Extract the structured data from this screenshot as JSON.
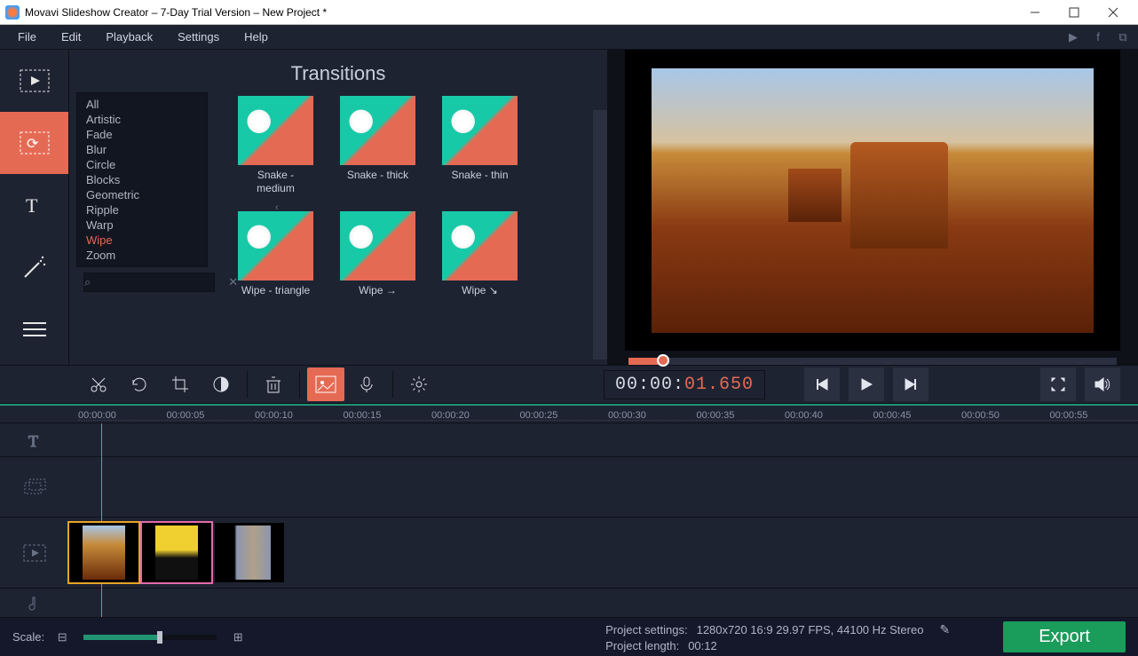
{
  "titlebar": {
    "title": "Movavi Slideshow Creator – 7-Day Trial Version – New Project *"
  },
  "menu": {
    "file": "File",
    "edit": "Edit",
    "playback": "Playback",
    "settings": "Settings",
    "help": "Help"
  },
  "browser": {
    "title": "Transitions",
    "categories": [
      "All",
      "Artistic",
      "Fade",
      "Blur",
      "Circle",
      "Blocks",
      "Geometric",
      "Ripple",
      "Warp",
      "Wipe",
      "Zoom"
    ],
    "selected_category": "Wipe",
    "items": [
      {
        "label": "Snake - medium"
      },
      {
        "label": "Snake - thick"
      },
      {
        "label": "Snake - thin"
      },
      {
        "label": "Wipe - triangle"
      },
      {
        "label": "Wipe →"
      },
      {
        "label": "Wipe ↘"
      }
    ],
    "search_placeholder": "",
    "clear_glyph": "✕"
  },
  "playback": {
    "time_prefix": "00:00:",
    "time_accent": "01.650"
  },
  "ruler": [
    "00:00:00",
    "00:00:05",
    "00:00:10",
    "00:00:15",
    "00:00:20",
    "00:00:25",
    "00:00:30",
    "00:00:35",
    "00:00:40",
    "00:00:45",
    "00:00:50",
    "00:00:55"
  ],
  "bottombar": {
    "scale_label": "Scale:",
    "proj_settings_label": "Project settings:",
    "proj_settings_value": "1280x720 16:9 29.97 FPS, 44100 Hz Stereo",
    "proj_length_label": "Project length:",
    "proj_length_value": "00:12",
    "export_label": "Export"
  }
}
